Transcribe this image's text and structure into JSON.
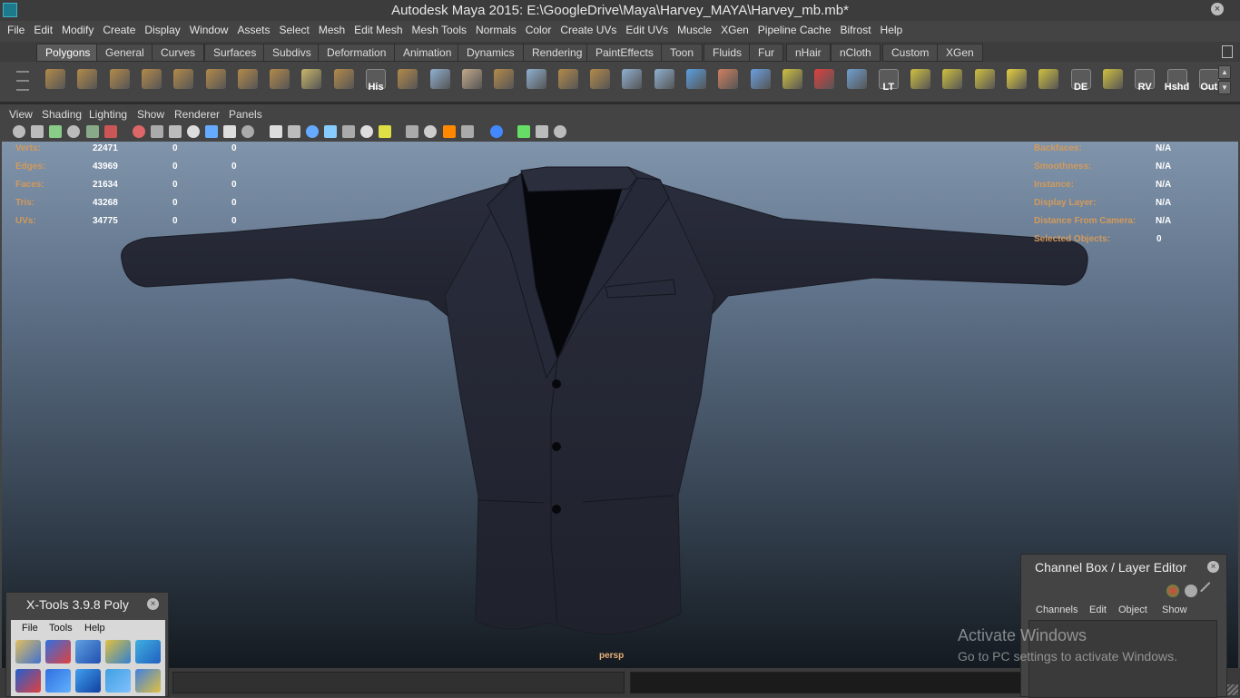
{
  "window": {
    "title": "Autodesk Maya 2015: E:\\GoogleDrive\\Maya\\Harvey_MAYA\\Harvey_mb.mb*",
    "close_glyph": "×"
  },
  "menubar": [
    "File",
    "Edit",
    "Modify",
    "Create",
    "Display",
    "Window",
    "Assets",
    "Select",
    "Mesh",
    "Edit Mesh",
    "Mesh Tools",
    "Normals",
    "Color",
    "Create UVs",
    "Edit UVs",
    "Muscle",
    "XGen",
    "Pipeline Cache",
    "Bifrost",
    "Help"
  ],
  "shelf_tabs": [
    "Polygons",
    "General",
    "Curves",
    "Surfaces",
    "Subdivs",
    "Deformation",
    "Animation",
    "Dynamics",
    "Rendering",
    "PaintEffects",
    "Toon",
    "Fluids",
    "Fur",
    "nHair",
    "nCloth",
    "Custom",
    "XGen"
  ],
  "active_shelf_tab": "Polygons",
  "shelf_icons": [
    {
      "name": "poly-sphere-icon",
      "label": "",
      "color": "#b48a4a"
    },
    {
      "name": "poly-cube-icon",
      "label": "",
      "color": "#b48a4a"
    },
    {
      "name": "poly-cylinder-icon",
      "label": "",
      "color": "#b48a4a"
    },
    {
      "name": "poly-cone-icon",
      "label": "",
      "color": "#b48a4a"
    },
    {
      "name": "poly-plane-icon",
      "label": "",
      "color": "#b48a4a"
    },
    {
      "name": "poly-torus-icon",
      "label": "",
      "color": "#b48a4a"
    },
    {
      "name": "poly-pyramid-icon",
      "label": "",
      "color": "#b48a4a"
    },
    {
      "name": "poly-pipe-icon",
      "label": "",
      "color": "#b48a4a"
    },
    {
      "name": "poly-helix-icon",
      "label": "",
      "color": "#c9b66a"
    },
    {
      "name": "poly-soccer-icon",
      "label": "",
      "color": "#b48a4a"
    },
    {
      "name": "history-icon",
      "label": "His",
      "color": "#ffffff"
    },
    {
      "name": "combine-sphere-icon",
      "label": "",
      "color": "#b48a4a"
    },
    {
      "name": "extract-cube-icon",
      "label": "",
      "color": "#8fb0d0"
    },
    {
      "name": "separate-icon",
      "label": "",
      "color": "#c4a98a"
    },
    {
      "name": "extrude-icon",
      "label": "",
      "color": "#b48a4a"
    },
    {
      "name": "bridge-icon",
      "label": "",
      "color": "#8fb0d0"
    },
    {
      "name": "append-icon",
      "label": "",
      "color": "#b48a4a"
    },
    {
      "name": "split-icon",
      "label": "",
      "color": "#b48a4a"
    },
    {
      "name": "insert-loop-icon",
      "label": "",
      "color": "#8fb0d0"
    },
    {
      "name": "offset-loop-icon",
      "label": "",
      "color": "#8fb0d0"
    },
    {
      "name": "sculpt-icon",
      "label": "",
      "color": "#5aa0e0"
    },
    {
      "name": "paint-icon",
      "label": "",
      "color": "#d08060"
    },
    {
      "name": "lattice-icon",
      "label": "",
      "color": "#6aa0e0"
    },
    {
      "name": "soft-mod-icon",
      "label": "",
      "color": "#d0c040"
    },
    {
      "name": "rotate-manip-icon",
      "label": "",
      "color": "#e04040"
    },
    {
      "name": "transfer-icon",
      "label": "",
      "color": "#70a0d0"
    },
    {
      "name": "lt-icon",
      "label": "LT",
      "color": "#dddddd"
    },
    {
      "name": "uv-unfold-icon",
      "label": "",
      "color": "#d0c040"
    },
    {
      "name": "uv-layout-icon",
      "label": "",
      "color": "#d0c040"
    },
    {
      "name": "uv-cut-icon",
      "label": "",
      "color": "#d0c040"
    },
    {
      "name": "uv-sew-icon",
      "label": "",
      "color": "#e6d040"
    },
    {
      "name": "uv-move-icon",
      "label": "",
      "color": "#d0c040"
    },
    {
      "name": "de-icon",
      "label": "DE",
      "color": "#70c060"
    },
    {
      "name": "uv-grid-icon",
      "label": "",
      "color": "#d0c040"
    },
    {
      "name": "rv-icon",
      "label": "RV",
      "color": "#dddddd"
    },
    {
      "name": "hshd-icon",
      "label": "Hshd",
      "color": "#dddddd"
    },
    {
      "name": "out-icon",
      "label": "Out",
      "color": "#dddddd"
    }
  ],
  "panel_menu": [
    "View",
    "Shading",
    "Lighting",
    "Show",
    "Renderer",
    "Panels"
  ],
  "hud_left": [
    {
      "label": "Verts:",
      "v1": "22471",
      "v2": "0",
      "v3": "0"
    },
    {
      "label": "Edges:",
      "v1": "43969",
      "v2": "0",
      "v3": "0"
    },
    {
      "label": "Faces:",
      "v1": "21634",
      "v2": "0",
      "v3": "0"
    },
    {
      "label": "Tris:",
      "v1": "43268",
      "v2": "0",
      "v3": "0"
    },
    {
      "label": "UVs:",
      "v1": "34775",
      "v2": "0",
      "v3": "0"
    }
  ],
  "hud_right": [
    {
      "label": "Backfaces:",
      "value": "N/A"
    },
    {
      "label": "Smoothness:",
      "value": "N/A"
    },
    {
      "label": "Instance:",
      "value": "N/A"
    },
    {
      "label": "Display Layer:",
      "value": "N/A"
    },
    {
      "label": "Distance From Camera:",
      "value": "N/A"
    },
    {
      "label": "Selected Objects:",
      "value": "0"
    }
  ],
  "camera_label": "persp",
  "xtools": {
    "title": "X-Tools 3.9.8 Poly",
    "menu": [
      "File",
      "Tools",
      "Help"
    ]
  },
  "channel_box": {
    "title": "Channel Box / Layer Editor",
    "menu": [
      "Channels",
      "Edit",
      "Object",
      "Show"
    ]
  },
  "watermark": {
    "line1": "Activate Windows",
    "line2": "Go to PC settings to activate Windows."
  }
}
